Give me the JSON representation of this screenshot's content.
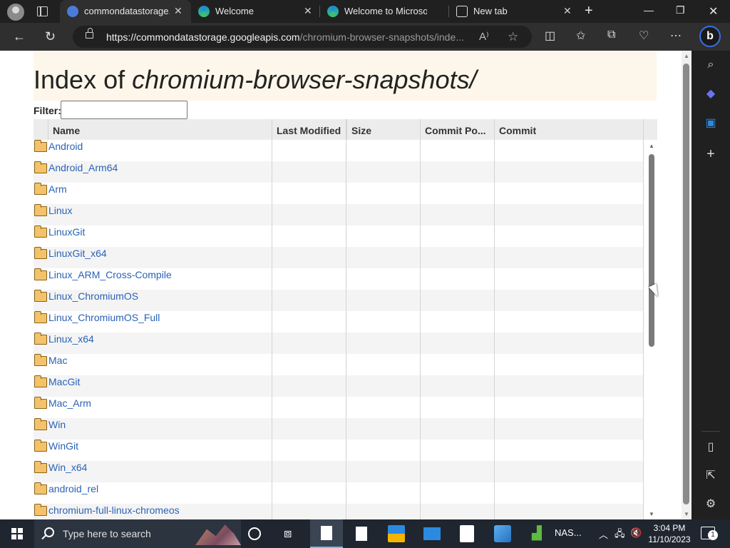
{
  "browser": {
    "tabs": [
      {
        "title": "commondatastorage.g",
        "active": true
      },
      {
        "title": "Welcome",
        "active": false
      },
      {
        "title": "Welcome to Microsoft",
        "active": false
      },
      {
        "title": "New tab",
        "active": false
      }
    ],
    "url_host": "https://commondatastorage.googleapis.com",
    "url_path": "/chromium-browser-snapshots/inde...",
    "accent_color": "#3a6ee8"
  },
  "page": {
    "title_prefix": "Index of ",
    "title_path": "chromium-browser-snapshots/",
    "filter_label": "Filter:",
    "filter_value": "",
    "columns": [
      "Name",
      "Last Modified",
      "Size",
      "Commit Po...",
      "Commit"
    ],
    "rows": [
      "Android",
      "Android_Arm64",
      "Arm",
      "Linux",
      "LinuxGit",
      "LinuxGit_x64",
      "Linux_ARM_Cross-Compile",
      "Linux_ChromiumOS",
      "Linux_ChromiumOS_Full",
      "Linux_x64",
      "Mac",
      "MacGit",
      "Mac_Arm",
      "Win",
      "WinGit",
      "Win_x64",
      "android_rel",
      "chromium-full-linux-chromeos"
    ],
    "link_color": "#2a62b6",
    "header_bg": "#fdf6ea"
  },
  "taskbar": {
    "search_placeholder": "Type here to search",
    "nas_label": "NAS...",
    "time": "3:04 PM",
    "date": "11/10/2023",
    "notification_count": "1"
  }
}
